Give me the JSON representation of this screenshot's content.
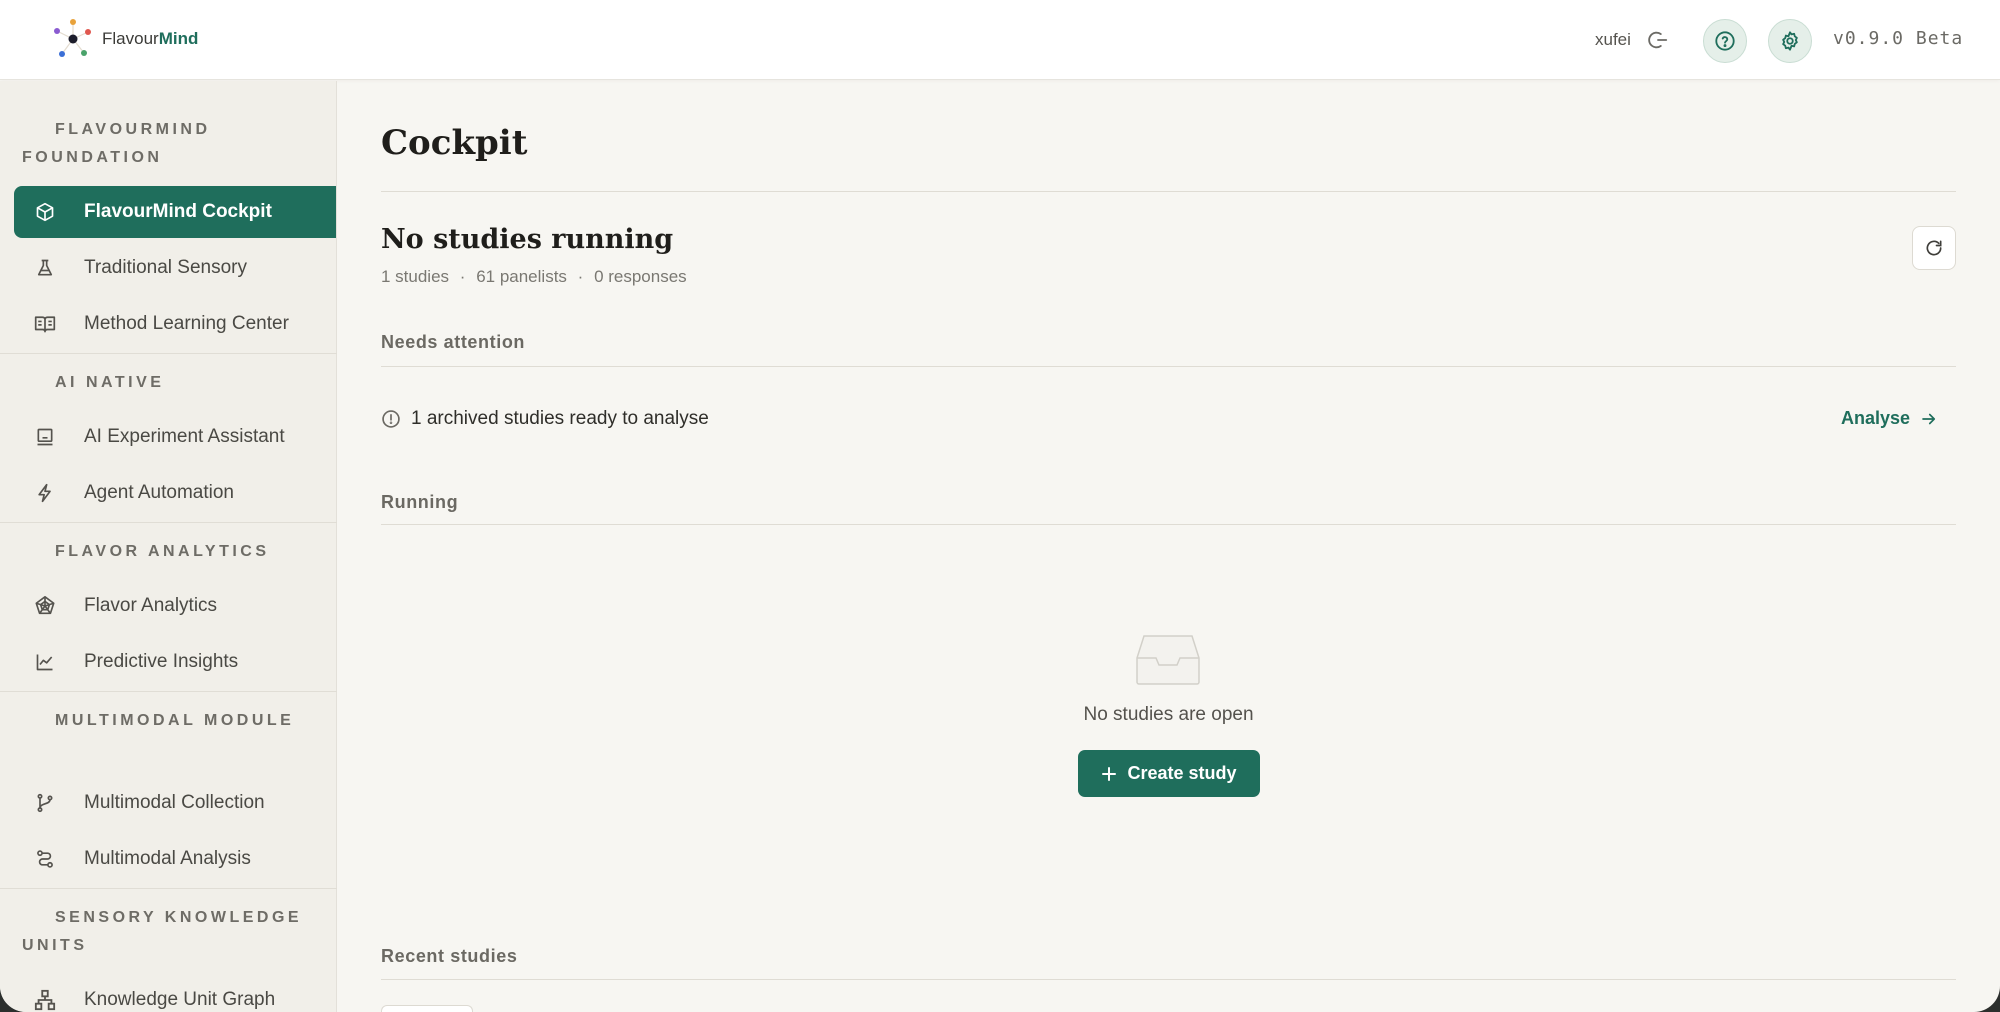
{
  "header": {
    "logo_text_a": "Flavour",
    "logo_text_b": "Mind",
    "user": "xufei",
    "version": "v0.9.0 Beta",
    "icons": [
      "logo-icon",
      "logout-icon",
      "help-icon",
      "settings-icon"
    ]
  },
  "sidebar": {
    "groups": [
      {
        "title": "FLAVOURMIND FOUNDATION",
        "items": [
          {
            "label": "FlavourMind Cockpit",
            "icon": "cube-icon",
            "active": true
          },
          {
            "label": "Traditional Sensory",
            "icon": "flask-icon"
          },
          {
            "label": "Method Learning Center",
            "icon": "book-icon"
          }
        ]
      },
      {
        "title": "AI NATIVE",
        "items": [
          {
            "label": "AI Experiment Assistant",
            "icon": "robot-icon"
          },
          {
            "label": "Agent Automation",
            "icon": "lightning-icon"
          }
        ]
      },
      {
        "title": "FLAVOR ANALYTICS",
        "items": [
          {
            "label": "Flavor Analytics",
            "icon": "radar-icon"
          },
          {
            "label": "Predictive Insights",
            "icon": "line-chart-icon"
          }
        ]
      },
      {
        "title": "MULTIMODAL MODULE",
        "items": [
          {
            "label": "Multimodal Collection",
            "icon": "branch-icon"
          },
          {
            "label": "Multimodal Analysis",
            "icon": "route-icon"
          }
        ]
      },
      {
        "title": "SENSORY KNOWLEDGE UNITS",
        "items": [
          {
            "label": "Knowledge Unit Graph",
            "icon": "network-icon"
          }
        ]
      }
    ]
  },
  "main": {
    "title": "Cockpit",
    "status_title": "No studies running",
    "stats": {
      "studies": "1 studies",
      "panelists": "61 panelists",
      "responses": "0 responses",
      "separator": "·"
    },
    "needs_attention_label": "Needs attention",
    "attention_text": "1 archived studies ready to analyse",
    "analyse_label": "Analyse",
    "running_label": "Running",
    "empty_text": "No studies are open",
    "create_label": "Create study",
    "recent_label": "Recent studies"
  },
  "colors": {
    "brand": "#1f6e5c",
    "background": "#f7f6f2",
    "sidebar": "#f1efe9"
  }
}
